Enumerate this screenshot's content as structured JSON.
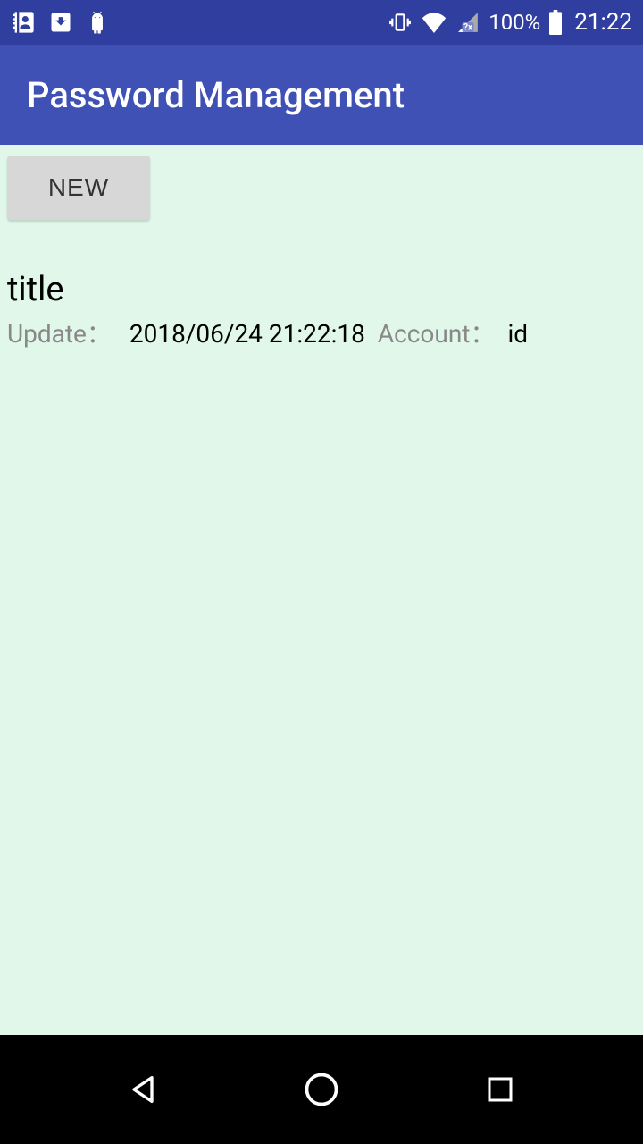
{
  "status": {
    "battery_pct": "100%",
    "time": "21:22"
  },
  "app": {
    "title": "Password Management"
  },
  "buttons": {
    "new_label": "NEW"
  },
  "item": {
    "title": "title",
    "update_label": "Update：",
    "update_value": "2018/06/24 21:22:18",
    "account_label": "Account：",
    "account_value": "id"
  }
}
